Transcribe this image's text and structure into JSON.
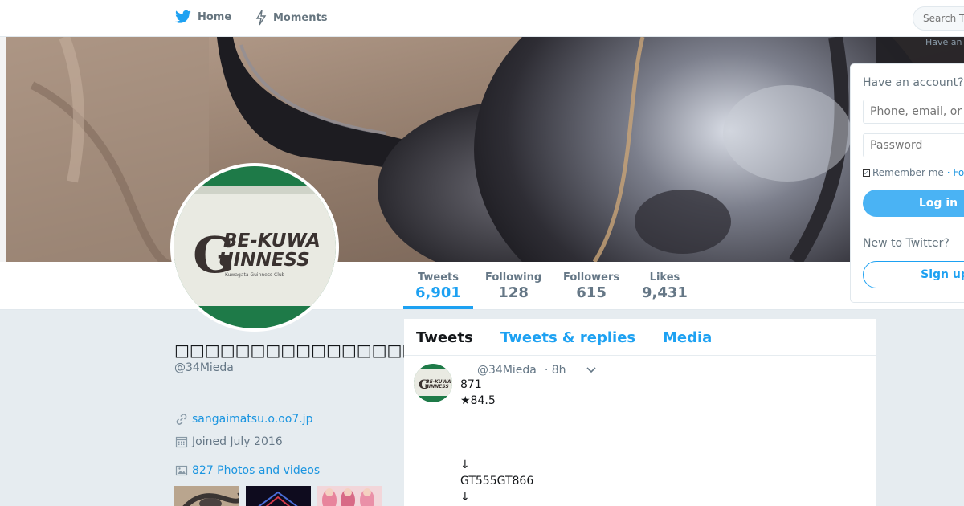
{
  "nav": {
    "home_label": "Home",
    "moments_label": "Moments",
    "search_placeholder": "Search Twitter",
    "have_account_mini": "Have an"
  },
  "profile": {
    "name": "□□□□□□□□□□□□□□□□□□",
    "handle": "@34Mieda",
    "link": "sangaimatsu.o.oo7.jp",
    "joined": "Joined July 2016",
    "photos": "827 Photos and videos",
    "avatar_text_1": "BE-KUWA",
    "avatar_text_2": "UINNESS",
    "avatar_letter": "G",
    "avatar_subtext": "Kuwagata Guinness Club"
  },
  "stats": [
    {
      "label": "Tweets",
      "value": "6,901"
    },
    {
      "label": "Following",
      "value": "128"
    },
    {
      "label": "Followers",
      "value": "615"
    },
    {
      "label": "Likes",
      "value": "9,431"
    }
  ],
  "timeline": {
    "tabs": [
      "Tweets",
      "Tweets & replies",
      "Media"
    ],
    "tweet": {
      "handle": "@34Mieda",
      "time": "· 8h",
      "lines": [
        "871",
        "★84.5",
        "↓",
        "GT555GT866",
        "↓"
      ]
    }
  },
  "login": {
    "title": "Have an account?",
    "phone_placeholder": "Phone, email, or username",
    "password_placeholder": "Password",
    "remember": "Remember me",
    "forgot": "· Forgot password?",
    "login_button": "Log in",
    "new_to": "New to Twitter?",
    "signup_button": "Sign up"
  },
  "colors": {
    "accent": "#1da1f2",
    "page_bg": "#e6ecf0",
    "avatar_green": "#1e7a48"
  }
}
